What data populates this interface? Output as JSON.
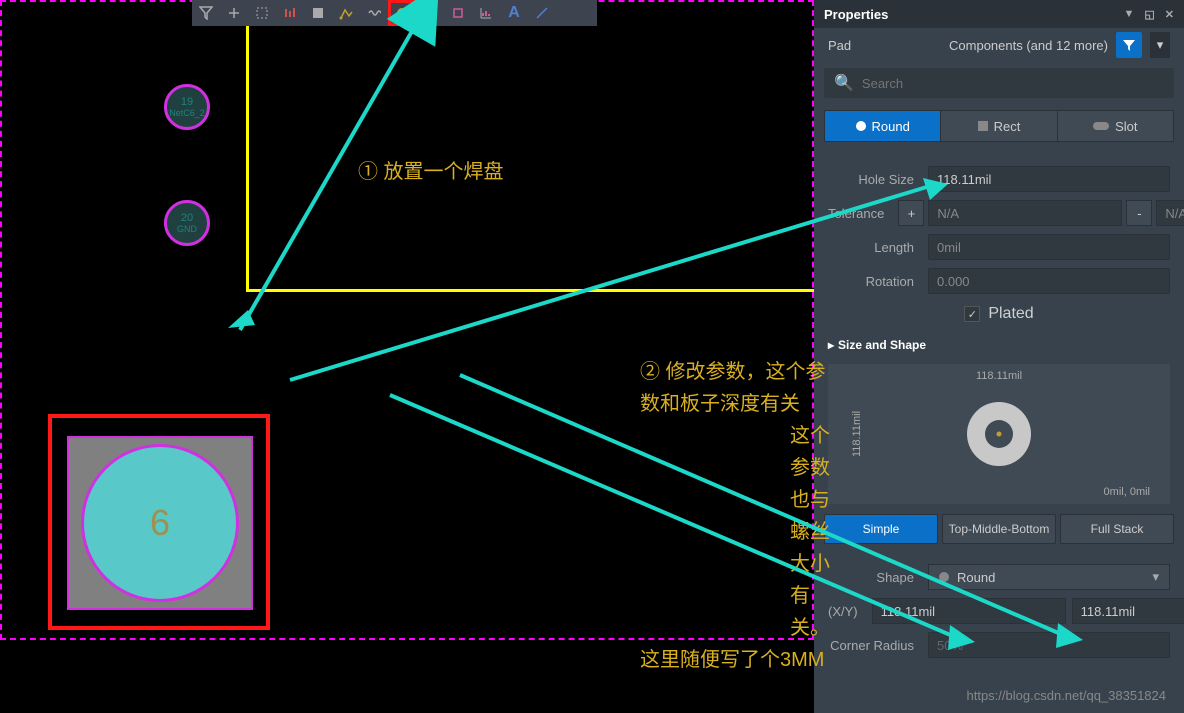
{
  "toolbar": {
    "items": [
      "filter",
      "plus",
      "select",
      "bar",
      "grid",
      "path",
      "tilde",
      "pad",
      "image",
      "box",
      "chart",
      "text",
      "line"
    ]
  },
  "pads": {
    "p19": {
      "num": "19",
      "net": "NetC6_2"
    },
    "p20": {
      "num": "20",
      "net": "GND"
    },
    "sel": {
      "num": "6"
    }
  },
  "annotations": {
    "a1": "① 放置一个焊盘",
    "a2_l1": "② 修改参数，这个参数和板子深度有关",
    "a2_l2": "这个参数也与螺丝大小有关。",
    "a2_l3": "这里随便写了个3MM"
  },
  "panel": {
    "title": "Properties",
    "object": "Pad",
    "filter_text": "Components (and 12 more)",
    "search_placeholder": "Search",
    "shape_tabs": {
      "round": "Round",
      "rect": "Rect",
      "slot": "Slot"
    },
    "hole_size_label": "Hole Size",
    "hole_size_value": "118.11mil",
    "tolerance_label": "Tolerance",
    "tol_plus": "+",
    "tol_minus": "-",
    "tol_na": "N/A",
    "length_label": "Length",
    "length_value": "0mil",
    "rotation_label": "Rotation",
    "rotation_value": "0.000",
    "plated_label": "Plated",
    "section_size": "Size and Shape",
    "preview_dim": "118.11mil",
    "preview_origin": "0mil, 0mil",
    "stack": {
      "simple": "Simple",
      "tmb": "Top-Middle-Bottom",
      "full": "Full Stack"
    },
    "shape_label": "Shape",
    "shape_value": "Round",
    "xy_label": "(X/Y)",
    "xy_x": "118.11mil",
    "xy_y": "118.11mil",
    "corner_label": "Corner Radius",
    "corner_value": "50%"
  },
  "watermark": "https://blog.csdn.net/qq_38351824"
}
